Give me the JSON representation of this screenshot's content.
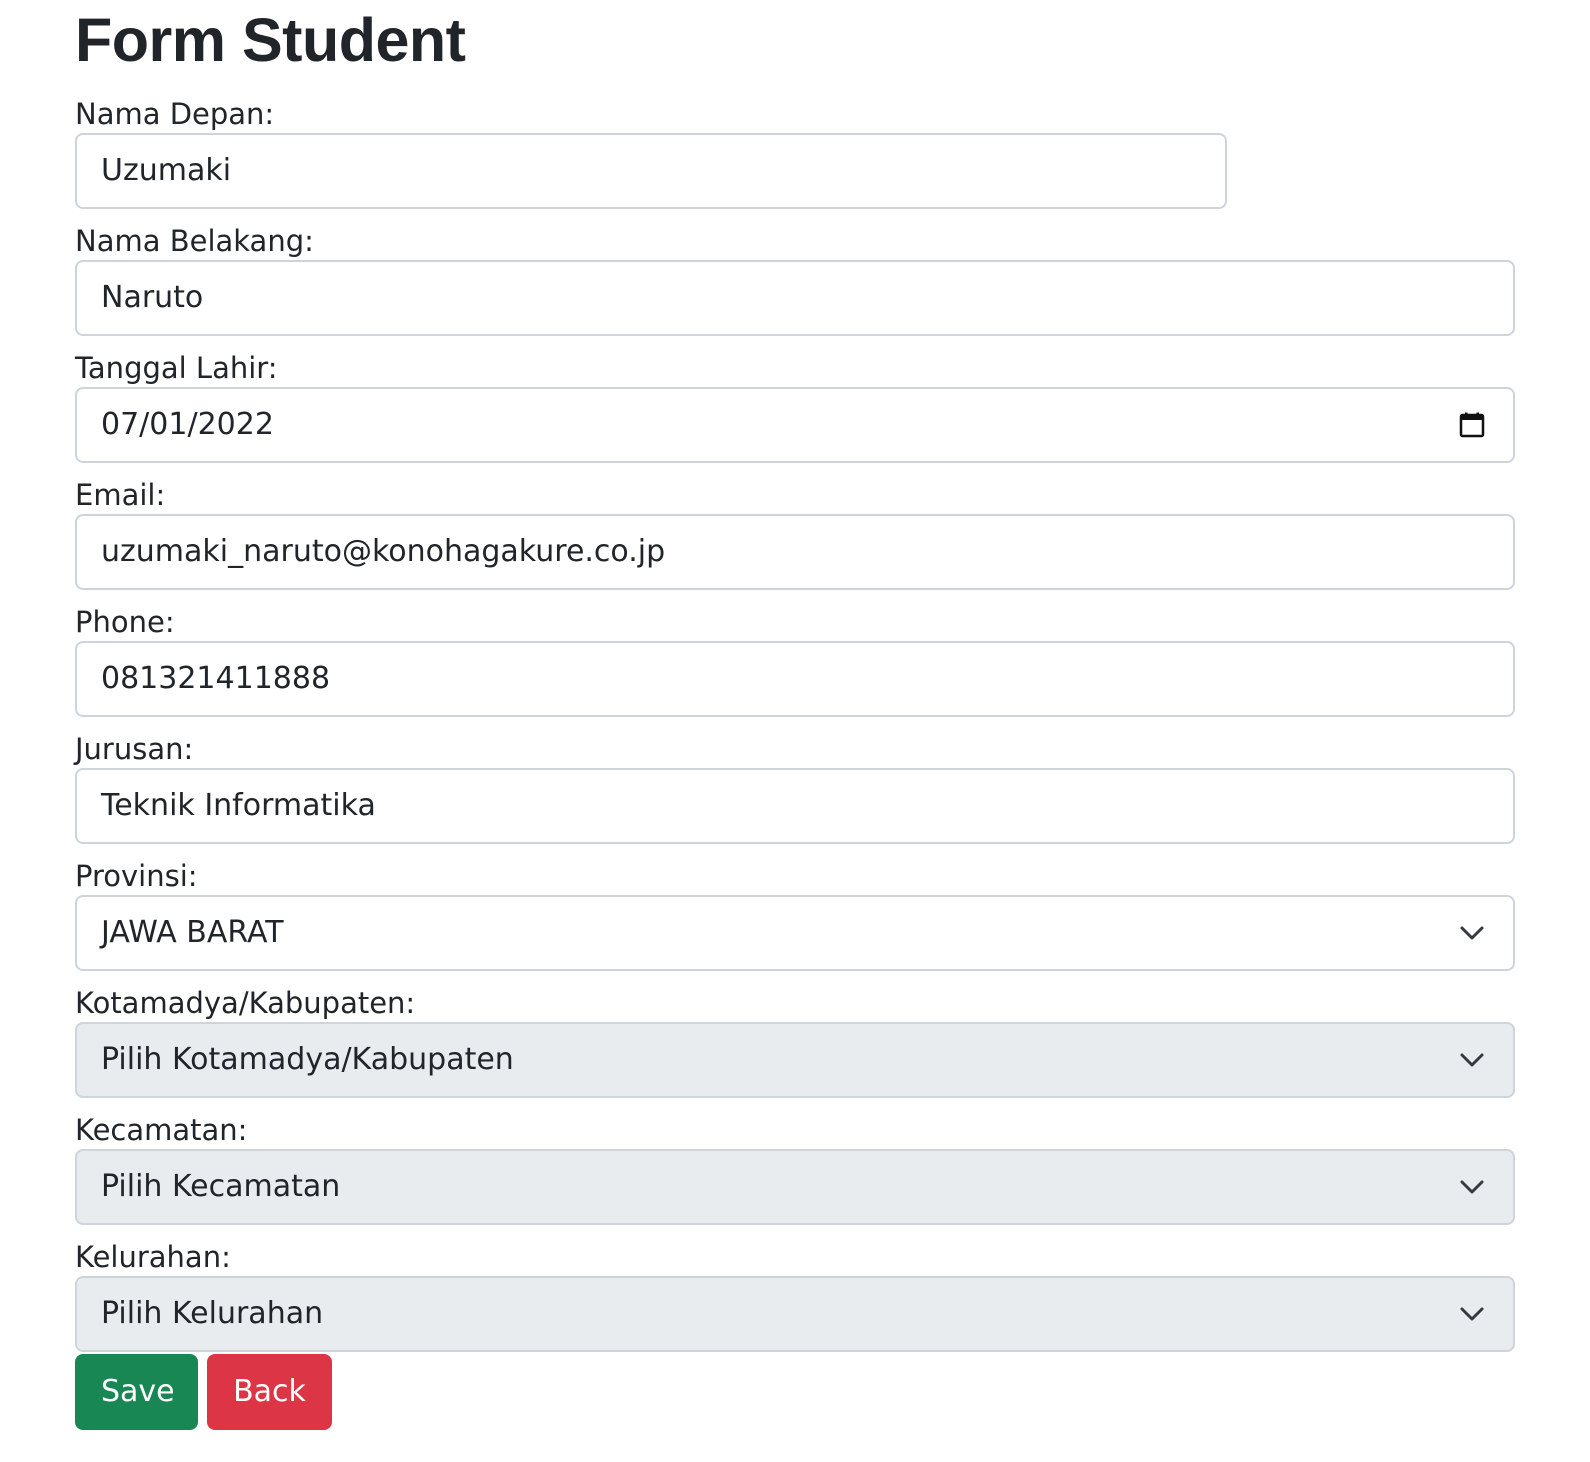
{
  "page": {
    "title": "Form Student"
  },
  "form": {
    "nama_depan": {
      "label": "Nama Depan:",
      "value": "Uzumaki"
    },
    "nama_belakang": {
      "label": "Nama Belakang:",
      "value": "Naruto"
    },
    "tanggal_lahir": {
      "label": "Tanggal Lahir:",
      "value": "07/01/2022",
      "icon": "calendar-icon"
    },
    "email": {
      "label": "Email:",
      "value": "uzumaki_naruto@konohagakure.co.jp"
    },
    "phone": {
      "label": "Phone:",
      "value": "081321411888"
    },
    "jurusan": {
      "label": "Jurusan:",
      "value": "Teknik Informatika"
    },
    "provinsi": {
      "label": "Provinsi:",
      "selected": "JAWA BARAT",
      "icon": "chevron-down-icon"
    },
    "kotamadya": {
      "label": "Kotamadya/Kabupaten:",
      "selected": "Pilih Kotamadya/Kabupaten",
      "icon": "chevron-down-icon"
    },
    "kecamatan": {
      "label": "Kecamatan:",
      "selected": "Pilih Kecamatan",
      "icon": "chevron-down-icon"
    },
    "kelurahan": {
      "label": "Kelurahan:",
      "selected": "Pilih Kelurahan",
      "icon": "chevron-down-icon"
    }
  },
  "buttons": {
    "save_label": "Save",
    "back_label": "Back"
  },
  "colors": {
    "save": "#198754",
    "back": "#dc3545",
    "disabled_bg": "#e9ecef",
    "border": "#ced4da",
    "text": "#212529"
  }
}
